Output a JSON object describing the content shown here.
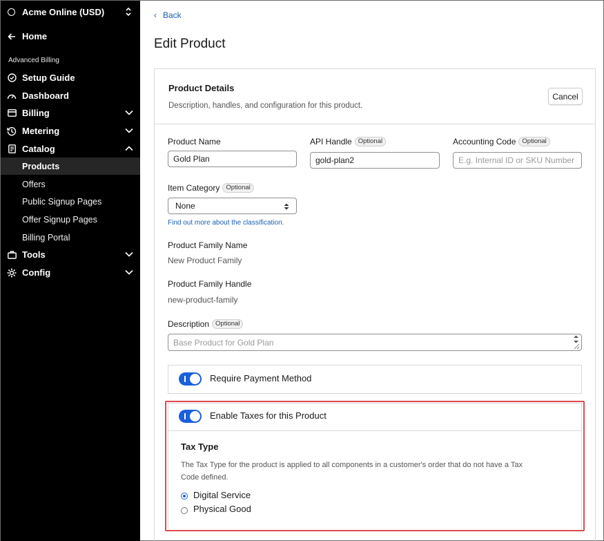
{
  "sidebar": {
    "org_name": "Acme Online (USD)",
    "home": "Home",
    "section": "Advanced Billing",
    "items": [
      {
        "label": "Setup Guide"
      },
      {
        "label": "Dashboard"
      },
      {
        "label": "Billing"
      },
      {
        "label": "Metering"
      },
      {
        "label": "Catalog"
      }
    ],
    "catalog_sub": [
      {
        "label": "Products"
      },
      {
        "label": "Offers"
      },
      {
        "label": "Public Signup Pages"
      },
      {
        "label": "Offer Signup Pages"
      },
      {
        "label": "Billing Portal"
      }
    ],
    "tools": "Tools",
    "config": "Config"
  },
  "main": {
    "back": "Back",
    "title": "Edit Product"
  },
  "card": {
    "title": "Product Details",
    "subtitle": "Description, handles, and configuration for this product.",
    "cancel": "Cancel",
    "optional_badge": "Optional",
    "product_name_label": "Product Name",
    "product_name_value": "Gold Plan",
    "api_handle_label": "API Handle",
    "api_handle_value": "gold-plan2",
    "accounting_code_label": "Accounting Code",
    "accounting_code_placeholder": "E.g. Internal ID or SKU Number",
    "item_category_label": "Item Category",
    "item_category_value": "None",
    "item_category_help": "Find out more about the classification.",
    "family_name_label": "Product Family Name",
    "family_name_value": "New Product Family",
    "family_handle_label": "Product Family Handle",
    "family_handle_value": "new-product-family",
    "description_label": "Description",
    "description_placeholder": "Base Product for Gold Plan",
    "require_payment_label": "Require Payment Method",
    "enable_taxes_label": "Enable Taxes for this Product",
    "tax_type_title": "Tax Type",
    "tax_type_desc_1": "The Tax Type for the product is applied to all components in a customer's order that do not have a Tax",
    "tax_type_desc_2": "Code defined.",
    "tax_options": [
      {
        "label": "Digital Service",
        "selected": true
      },
      {
        "label": "Physical Good",
        "selected": false
      }
    ]
  },
  "colors": {
    "accent": "#1a5fdc",
    "link": "#1a5fb4",
    "highlight": "#e0494f",
    "sidebar_bg": "#000000"
  }
}
